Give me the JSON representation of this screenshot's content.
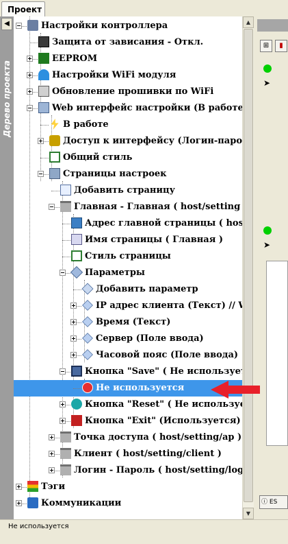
{
  "tab": {
    "label": "Проект"
  },
  "sidebar": {
    "title": "Дерево проекта",
    "toggle_glyph": "◀"
  },
  "tree": [
    {
      "label": "Настройки контроллера",
      "icon": "tools-icon",
      "level": 0,
      "expanded": true
    },
    {
      "label": "Защита от зависания - Откл.",
      "icon": "watchdog-icon",
      "level": 1,
      "expander": "none"
    },
    {
      "label": "EEPROM",
      "icon": "chip-icon",
      "level": 1,
      "expander": "plus"
    },
    {
      "label": "Настройки WiFi модуля",
      "icon": "wifi-icon",
      "level": 1,
      "expander": "plus"
    },
    {
      "label": "Обновление прошивки по WiFi",
      "icon": "firmware-icon",
      "level": 1,
      "expander": "plus"
    },
    {
      "label": "Web интерфейс настройки (В работе)",
      "icon": "web-icon",
      "level": 1,
      "expander": "minus"
    },
    {
      "label": "В работе",
      "icon": "lightning-icon",
      "level": 2,
      "expander": "none"
    },
    {
      "label": "Доступ к интерфейсу (Логин-пароль",
      "icon": "lock-icon",
      "level": 2,
      "expander": "plus"
    },
    {
      "label": "Общий стиль",
      "icon": "style-icon",
      "level": 2,
      "expander": "none"
    },
    {
      "label": "Страницы настроек",
      "icon": "pages-icon",
      "level": 2,
      "expander": "minus"
    },
    {
      "label": "Добавить страницу",
      "icon": "add-page-icon",
      "level": 3,
      "expander": "none"
    },
    {
      "label": "Главная - Главная ( host/setting )",
      "icon": "page-icon",
      "level": 3,
      "expander": "minus"
    },
    {
      "label": "Адрес главной страницы ( host",
      "icon": "address-icon",
      "level": 4,
      "expander": "none"
    },
    {
      "label": "Имя страницы ( Главная )",
      "icon": "name-icon",
      "level": 4,
      "expander": "none"
    },
    {
      "label": "Стиль страницы",
      "icon": "style-icon",
      "level": 4,
      "expander": "none"
    },
    {
      "label": "Параметры",
      "icon": "params-icon",
      "level": 4,
      "expander": "minus"
    },
    {
      "label": "Добавить параметр",
      "icon": "add-param-icon",
      "level": 5,
      "expander": "none"
    },
    {
      "label": "IP адрес клиента (Текст) // W",
      "icon": "tag-icon",
      "level": 5,
      "expander": "plus"
    },
    {
      "label": "Время (Текст)",
      "icon": "tag-icon",
      "level": 5,
      "expander": "plus"
    },
    {
      "label": "Сервер (Поле ввода)",
      "icon": "tag-icon",
      "level": 5,
      "expander": "plus"
    },
    {
      "label": "Часовой пояс (Поле ввода)",
      "icon": "tag-icon",
      "level": 5,
      "expander": "plus"
    },
    {
      "label": "Кнопка \"Save\" ( Не используется",
      "icon": "save-icon",
      "level": 4,
      "expander": "minus"
    },
    {
      "label": "Не используется",
      "icon": "error-icon",
      "level": 5,
      "expander": "none",
      "selected": true
    },
    {
      "label": "Кнопка \"Reset\" ( Не используется",
      "icon": "reset-icon",
      "level": 4,
      "expander": "plus"
    },
    {
      "label": "Кнопка \"Exit\" (Используется)",
      "icon": "exit-icon",
      "level": 4,
      "expander": "plus"
    },
    {
      "label": "Точка доступа ( host/setting/ap )",
      "icon": "page-icon",
      "level": 3,
      "expander": "plus"
    },
    {
      "label": "Клиент ( host/setting/client )",
      "icon": "page-icon",
      "level": 3,
      "expander": "plus"
    },
    {
      "label": "Логин - Пароль ( host/setting/login",
      "icon": "page-icon",
      "level": 3,
      "expander": "plus"
    },
    {
      "label": "Тэги",
      "icon": "tags-icon",
      "level": 0,
      "expander": "plus"
    },
    {
      "label": "Коммуникации",
      "icon": "comm-icon",
      "level": 0,
      "expander": "plus"
    }
  ],
  "right_panel": {
    "bottom_label": "ES"
  },
  "status": {
    "text": "Не используется"
  },
  "colors": {
    "selection": "#3e96ea",
    "arrow": "#e8202a"
  }
}
